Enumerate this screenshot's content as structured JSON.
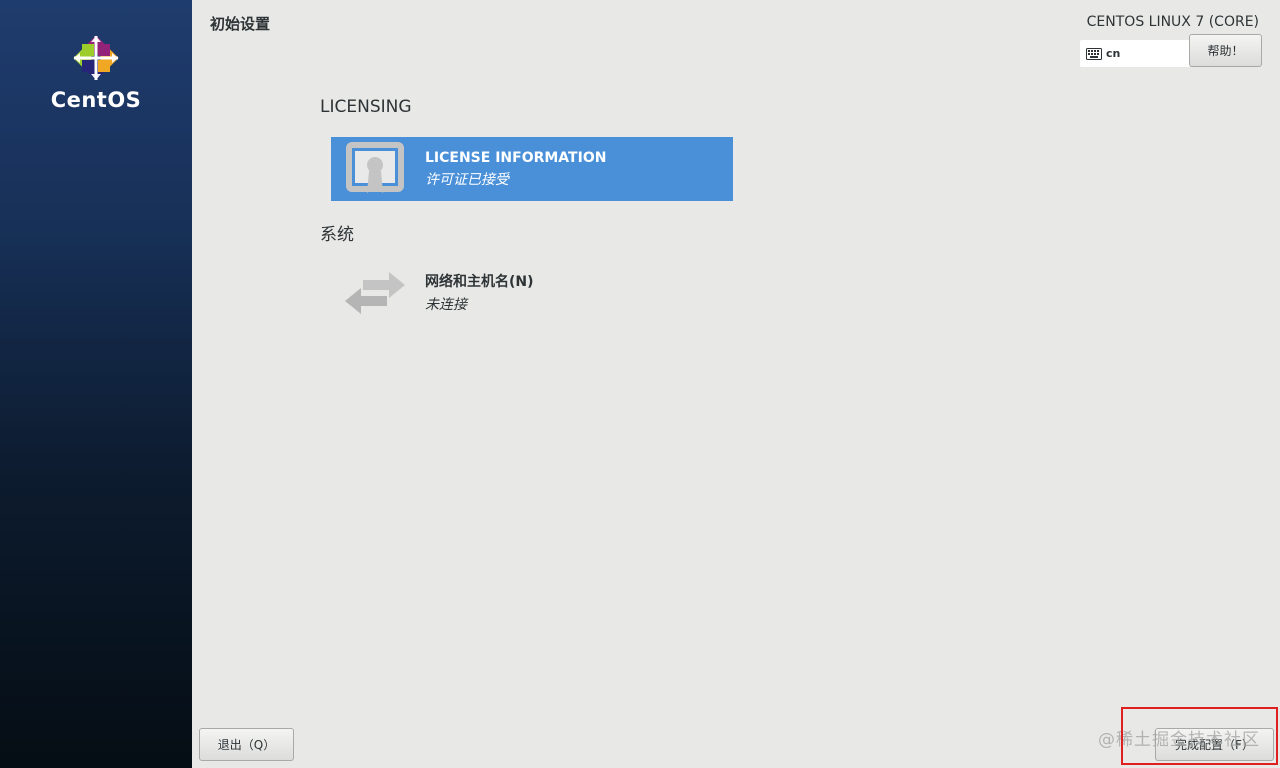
{
  "sidebar": {
    "logo_text": "CentOS"
  },
  "header": {
    "page_title": "初始设置",
    "product_name": "CENTOS LINUX 7 (CORE)",
    "keyboard_layout": "cn",
    "help_label": "帮助！"
  },
  "sections": {
    "licensing": {
      "title": "LICENSING",
      "license_spoke": {
        "title": "LICENSE INFORMATION",
        "status": "许可证已接受",
        "icon": "license-certificate-icon"
      }
    },
    "system": {
      "title": "系统",
      "network_spoke": {
        "title": "网络和主机名(N)",
        "status": "未连接",
        "icon": "network-arrows-icon"
      }
    }
  },
  "footer": {
    "quit_label": "退出（Q）",
    "finish_label": "完成配置（F）"
  },
  "watermark": "@稀土掘金技术社区",
  "colors": {
    "selected_spoke": "#4a90d9",
    "highlight": "#e02020",
    "sidebar_top": "#1f3c6e",
    "sidebar_bottom": "#050d14"
  }
}
